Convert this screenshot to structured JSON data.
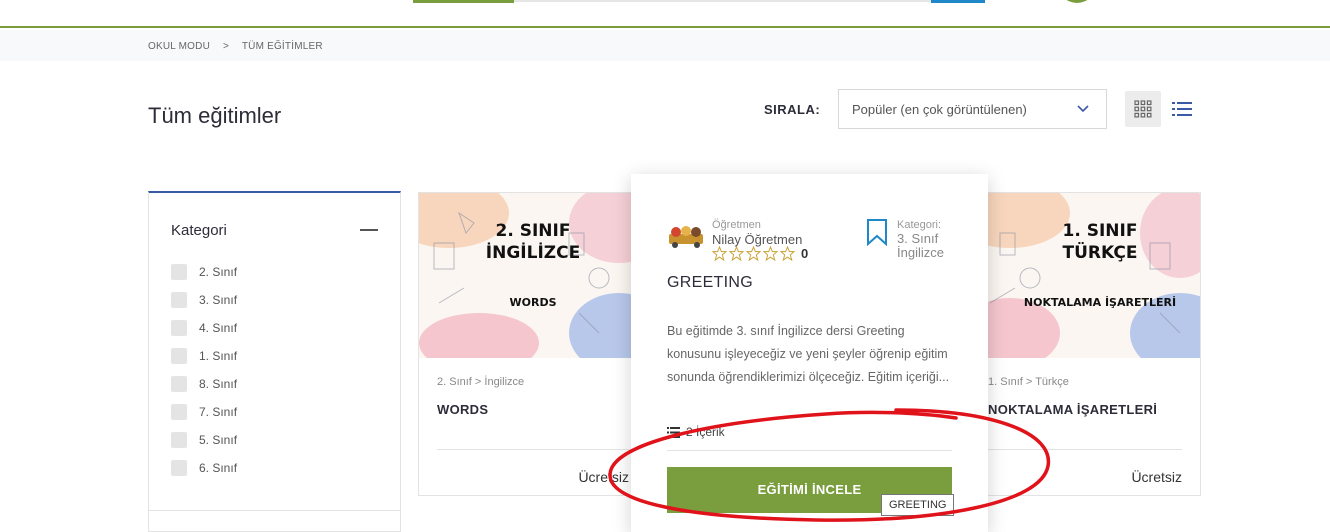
{
  "breadcrumb": [
    "OKUL MODU",
    ">",
    "TÜM EĞİTİMLER"
  ],
  "page_title": "Tüm eğitimler",
  "sort": {
    "label": "SIRALA:",
    "selected": "Popüler (en çok görüntülenen)"
  },
  "view_modes": {
    "grid_icon": "grid-icon",
    "list_icon": "list-icon",
    "active": "grid"
  },
  "sidebar": {
    "title": "Kategori",
    "items": [
      {
        "label": "2. Sınıf"
      },
      {
        "label": "3. Sınıf"
      },
      {
        "label": "4. Sınıf"
      },
      {
        "label": "1. Sınıf"
      },
      {
        "label": "8. Sınıf"
      },
      {
        "label": "7. Sınıf"
      },
      {
        "label": "5. Sınıf"
      },
      {
        "label": "6. Sınıf"
      }
    ]
  },
  "cards": [
    {
      "thumb_line1": "2. SINIF",
      "thumb_line2": "İNGİLİZCE",
      "thumb_sub": "WORDS",
      "meta": "2. Sınıf > İngilizce",
      "title": "WORDS",
      "price": "Ücretsiz"
    },
    {
      "thumb_line1": "1. SINIF",
      "thumb_line2": "TÜRKÇE",
      "thumb_sub": "NOKTALAMA İŞARETLERİ",
      "meta": "1. Sınıf > Türkçe",
      "title": "NOKTALAMA İŞARETLERİ",
      "price": "Ücretsiz"
    }
  ],
  "popup": {
    "teacher_label": "Öğretmen",
    "teacher_name": "Nilay Öğretmen",
    "rating_count": "0",
    "category_label": "Kategori:",
    "category_value": "3. Sınıf İngilizce",
    "title": "GREETING",
    "description": "Bu eğitimde 3. sınıf İngilizce dersi Greeting konusunu işleyeceğiz ve yeni şeyler öğrenip eğitim sonunda öğrendiklerimizi ölçeceğiz. Eğitim içeriği...",
    "content_count": "2 İçerik",
    "button_label": "EĞİTİMİ İNCELE",
    "tooltip": "GREETING"
  },
  "colors": {
    "accent_green": "#7a9e3e",
    "accent_blue": "#3a5aa8",
    "annotation_red": "#e0121a"
  }
}
